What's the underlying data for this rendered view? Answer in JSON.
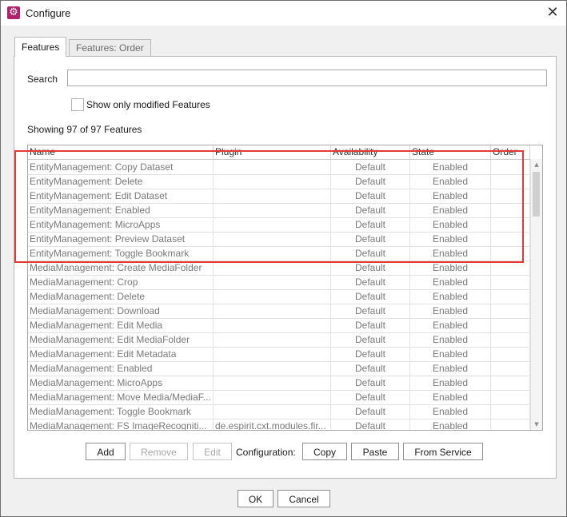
{
  "window": {
    "title": "Configure",
    "icon": "gear-icon",
    "close_glyph": "✕"
  },
  "tabs": [
    {
      "label": "Features",
      "active": true
    },
    {
      "label": "Features: Order",
      "active": false
    }
  ],
  "search": {
    "label": "Search",
    "value": "",
    "placeholder": ""
  },
  "filter": {
    "label": "Show only modified Features",
    "checked": false
  },
  "summary": "Showing 97 of 97 Features",
  "table": {
    "columns": [
      "Name",
      "Plugin",
      "Availability",
      "State",
      "Order"
    ],
    "rows": [
      {
        "name": "EntityManagement: Copy Dataset",
        "plugin": "",
        "availability": "Default",
        "state": "Enabled",
        "order": ""
      },
      {
        "name": "EntityManagement: Delete",
        "plugin": "",
        "availability": "Default",
        "state": "Enabled",
        "order": ""
      },
      {
        "name": "EntityManagement: Edit Dataset",
        "plugin": "",
        "availability": "Default",
        "state": "Enabled",
        "order": ""
      },
      {
        "name": "EntityManagement: Enabled",
        "plugin": "",
        "availability": "Default",
        "state": "Enabled",
        "order": ""
      },
      {
        "name": "EntityManagement: MicroApps",
        "plugin": "",
        "availability": "Default",
        "state": "Enabled",
        "order": ""
      },
      {
        "name": "EntityManagement: Preview Dataset",
        "plugin": "",
        "availability": "Default",
        "state": "Enabled",
        "order": ""
      },
      {
        "name": "EntityManagement: Toggle Bookmark",
        "plugin": "",
        "availability": "Default",
        "state": "Enabled",
        "order": ""
      },
      {
        "name": "MediaManagement: Create MediaFolder",
        "plugin": "",
        "availability": "Default",
        "state": "Enabled",
        "order": ""
      },
      {
        "name": "MediaManagement: Crop",
        "plugin": "",
        "availability": "Default",
        "state": "Enabled",
        "order": ""
      },
      {
        "name": "MediaManagement: Delete",
        "plugin": "",
        "availability": "Default",
        "state": "Enabled",
        "order": ""
      },
      {
        "name": "MediaManagement: Download",
        "plugin": "",
        "availability": "Default",
        "state": "Enabled",
        "order": ""
      },
      {
        "name": "MediaManagement: Edit Media",
        "plugin": "",
        "availability": "Default",
        "state": "Enabled",
        "order": ""
      },
      {
        "name": "MediaManagement: Edit MediaFolder",
        "plugin": "",
        "availability": "Default",
        "state": "Enabled",
        "order": ""
      },
      {
        "name": "MediaManagement: Edit Metadata",
        "plugin": "",
        "availability": "Default",
        "state": "Enabled",
        "order": ""
      },
      {
        "name": "MediaManagement: Enabled",
        "plugin": "",
        "availability": "Default",
        "state": "Enabled",
        "order": ""
      },
      {
        "name": "MediaManagement: MicroApps",
        "plugin": "",
        "availability": "Default",
        "state": "Enabled",
        "order": ""
      },
      {
        "name": "MediaManagement: Move Media/MediaF...",
        "plugin": "",
        "availability": "Default",
        "state": "Enabled",
        "order": ""
      },
      {
        "name": "MediaManagement: Toggle Bookmark",
        "plugin": "",
        "availability": "Default",
        "state": "Enabled",
        "order": ""
      },
      {
        "name": "MediaManagement: FS ImageRecogniti...",
        "plugin": "de.espirit.cxt.modules.fir...",
        "availability": "Default",
        "state": "Enabled",
        "order": ""
      }
    ]
  },
  "scrollbar": {
    "up_glyph": "▲",
    "down_glyph": "▼"
  },
  "actions": {
    "add": "Add",
    "remove": "Remove",
    "edit": "Edit",
    "configuration_label": "Configuration:",
    "copy": "Copy",
    "paste": "Paste",
    "from_service": "From Service"
  },
  "footer": {
    "ok": "OK",
    "cancel": "Cancel"
  },
  "colors": {
    "app_icon": "#b0226b",
    "highlight": "#e53935"
  }
}
